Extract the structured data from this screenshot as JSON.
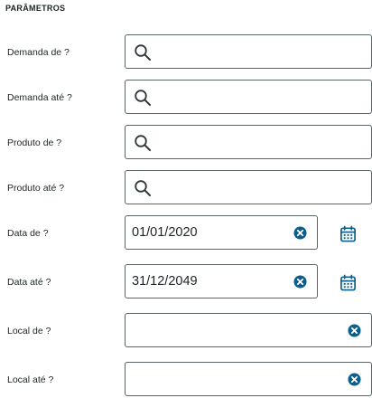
{
  "section_title": "PARÂMETROS",
  "params": [
    {
      "label": "Demanda de ?",
      "value": ""
    },
    {
      "label": "Demanda até ?",
      "value": ""
    },
    {
      "label": "Produto de ?",
      "value": ""
    },
    {
      "label": "Produto até ?",
      "value": ""
    },
    {
      "label": "Data de ?",
      "value": "01/01/2020"
    },
    {
      "label": "Data até ?",
      "value": "31/12/2049"
    },
    {
      "label": "Local de ?",
      "value": ""
    },
    {
      "label": "Local até ?",
      "value": ""
    }
  ],
  "colors": {
    "accent": "#0c5f8a",
    "border": "#5a6467",
    "text": "#1d2426"
  },
  "icons": {
    "search": "search-icon",
    "clear": "clear-icon",
    "calendar": "calendar-icon"
  }
}
